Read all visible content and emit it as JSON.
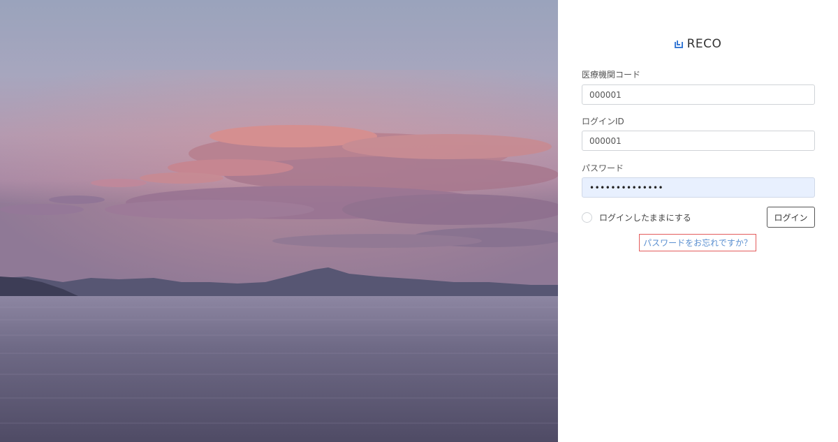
{
  "background": {
    "image": "sunset-over-lake-photo"
  },
  "brand": {
    "logo_icon": "reco-logo-mark",
    "name": "RECO",
    "accent_color": "#3a7bd5"
  },
  "form": {
    "facility_code": {
      "label": "医療機関コード",
      "value": "000001"
    },
    "login_id": {
      "label": "ログインID",
      "value": "000001"
    },
    "password": {
      "label": "パスワード",
      "value": "••••••••••••••"
    },
    "remember_label": "ログインしたままにする",
    "login_button": "ログイン",
    "forgot_link": "パスワードをお忘れですか？"
  }
}
